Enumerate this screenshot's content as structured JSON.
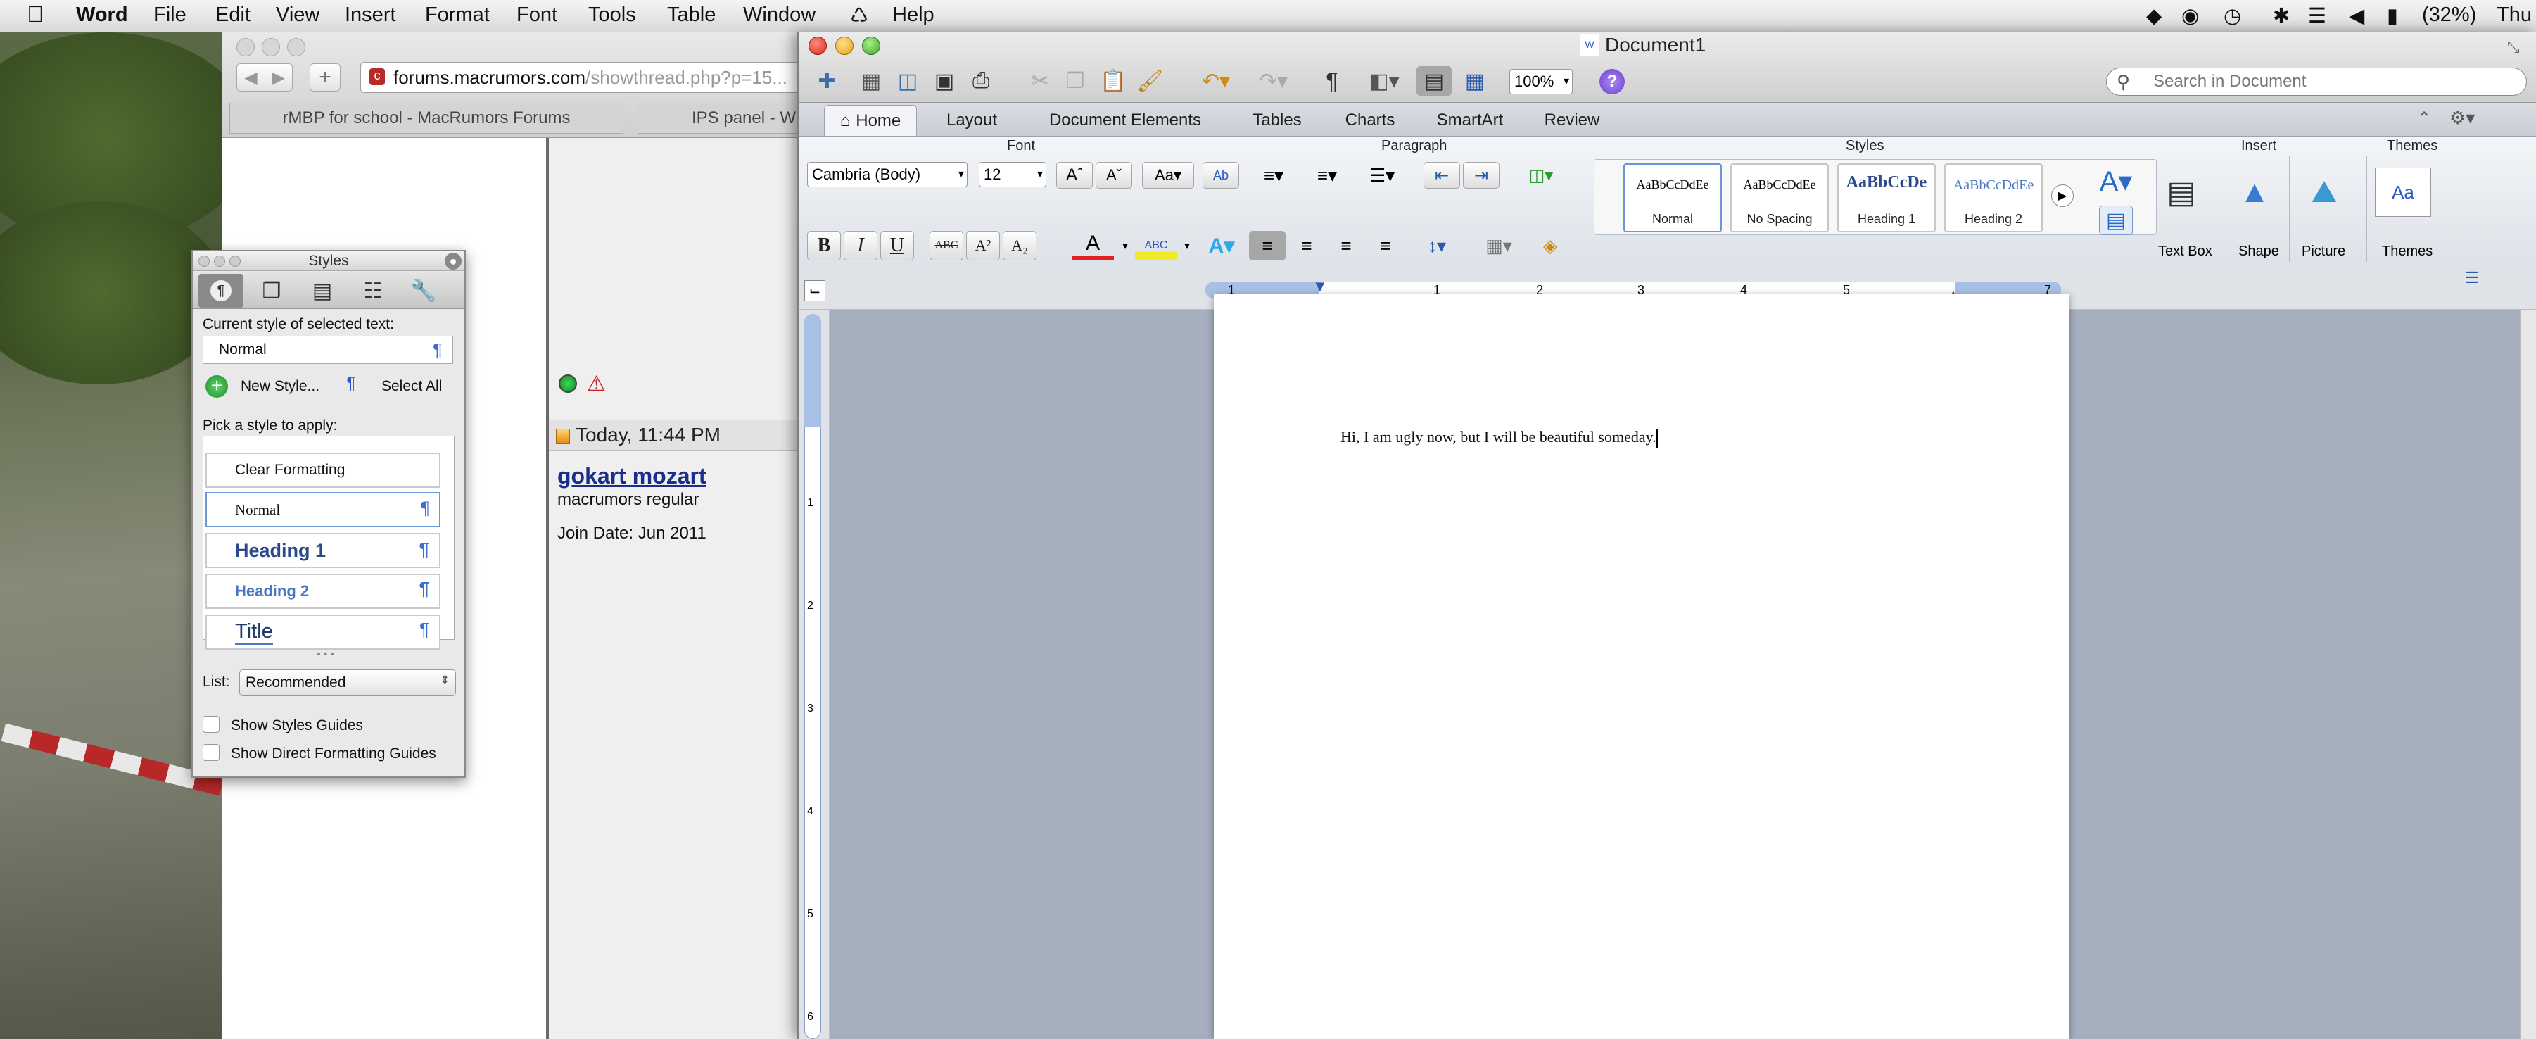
{
  "menubar": {
    "app": "Word",
    "items": [
      "File",
      "Edit",
      "View",
      "Insert",
      "Format",
      "Font",
      "Tools",
      "Table",
      "Window",
      "Help"
    ],
    "battery": "(32%)",
    "clock": "Thu"
  },
  "browser": {
    "url_host": "forums.macrumors.com",
    "url_path": "/showthread.php?p=15...",
    "tabs": [
      "rMBP for school - MacRumors Forums",
      "IPS panel - Wikip"
    ],
    "post_time": "Today, 11:44 PM",
    "username": "gokart mozart",
    "user_title": "macrumors regular",
    "join_date": "Join Date: Jun 2011"
  },
  "styles_palette": {
    "title": "Styles",
    "current_label": "Current style of selected text:",
    "current_value": "Normal",
    "new_style": "New Style...",
    "select_all": "Select All",
    "pick_label": "Pick a style to apply:",
    "items": [
      "Clear Formatting",
      "Normal",
      "Heading 1",
      "Heading 2",
      "Title"
    ],
    "list_label": "List:",
    "list_value": "Recommended",
    "show_guides": "Show Styles Guides",
    "show_direct": "Show Direct Formatting Guides"
  },
  "word": {
    "title": "Document1",
    "zoom": "100%",
    "search_placeholder": "Search in Document",
    "tabs": [
      "Home",
      "Layout",
      "Document Elements",
      "Tables",
      "Charts",
      "SmartArt",
      "Review"
    ],
    "groups": {
      "font": "Font",
      "paragraph": "Paragraph",
      "styles": "Styles",
      "insert": "Insert",
      "themes": "Themes"
    },
    "font_name": "Cambria (Body)",
    "font_size": "12",
    "style_gallery": [
      {
        "preview": "AaBbCcDdEe",
        "caption": "Normal"
      },
      {
        "preview": "AaBbCcDdEe",
        "caption": "No Spacing"
      },
      {
        "preview": "AaBbCcDe",
        "caption": "Heading 1"
      },
      {
        "preview": "AaBbCcDdEe",
        "caption": "Heading 2"
      }
    ],
    "insert_items": [
      "Text Box",
      "Shape",
      "Picture"
    ],
    "themes_label": "Themes",
    "ruler_marks": [
      "1",
      "1",
      "2",
      "3",
      "4",
      "5",
      "7"
    ],
    "vruler_marks": [
      "1",
      "2",
      "3",
      "4",
      "5",
      "6"
    ],
    "doc_text": "Hi, I am ugly now, but I will be beautiful someday."
  }
}
